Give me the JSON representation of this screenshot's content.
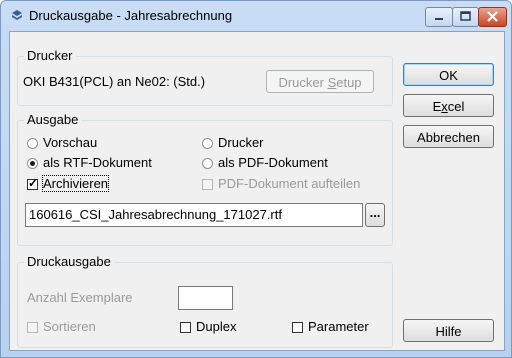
{
  "window": {
    "title": "Druckausgabe - Jahresabrechnung"
  },
  "drucker": {
    "legend": "Drucker",
    "printer_name": "OKI B431(PCL) an Ne02: (Std.)",
    "setup_button_pre": "Drucker ",
    "setup_button_ul": "S",
    "setup_button_post": "etup"
  },
  "ausgabe": {
    "legend": "Ausgabe",
    "radio_vorschau": "Vorschau",
    "radio_drucker": "Drucker",
    "radio_rtf": "als RTF-Dokument",
    "radio_pdf": "als PDF-Dokument",
    "selected": "als RTF-Dokument",
    "check_archivieren": "Archivieren",
    "archivieren_checked": true,
    "check_pdf_aufteilen": "PDF-Dokument aufteilen",
    "pdf_aufteilen_checked": false,
    "filename": "160616_CSI_Jahresabrechnung_171027.rtf",
    "browse_label": "..."
  },
  "druckausgabe": {
    "legend": "Druckausgabe",
    "anzahl_label": "Anzahl Exemplare",
    "anzahl_value": "",
    "check_sortieren": "Sortieren",
    "check_duplex": "Duplex",
    "check_parameter": "Parameter"
  },
  "buttons": {
    "ok": "OK",
    "excel_pre": "E",
    "excel_ul": "x",
    "excel_post": "cel",
    "abbrechen": "Abbrechen",
    "hilfe": "Hilfe"
  }
}
